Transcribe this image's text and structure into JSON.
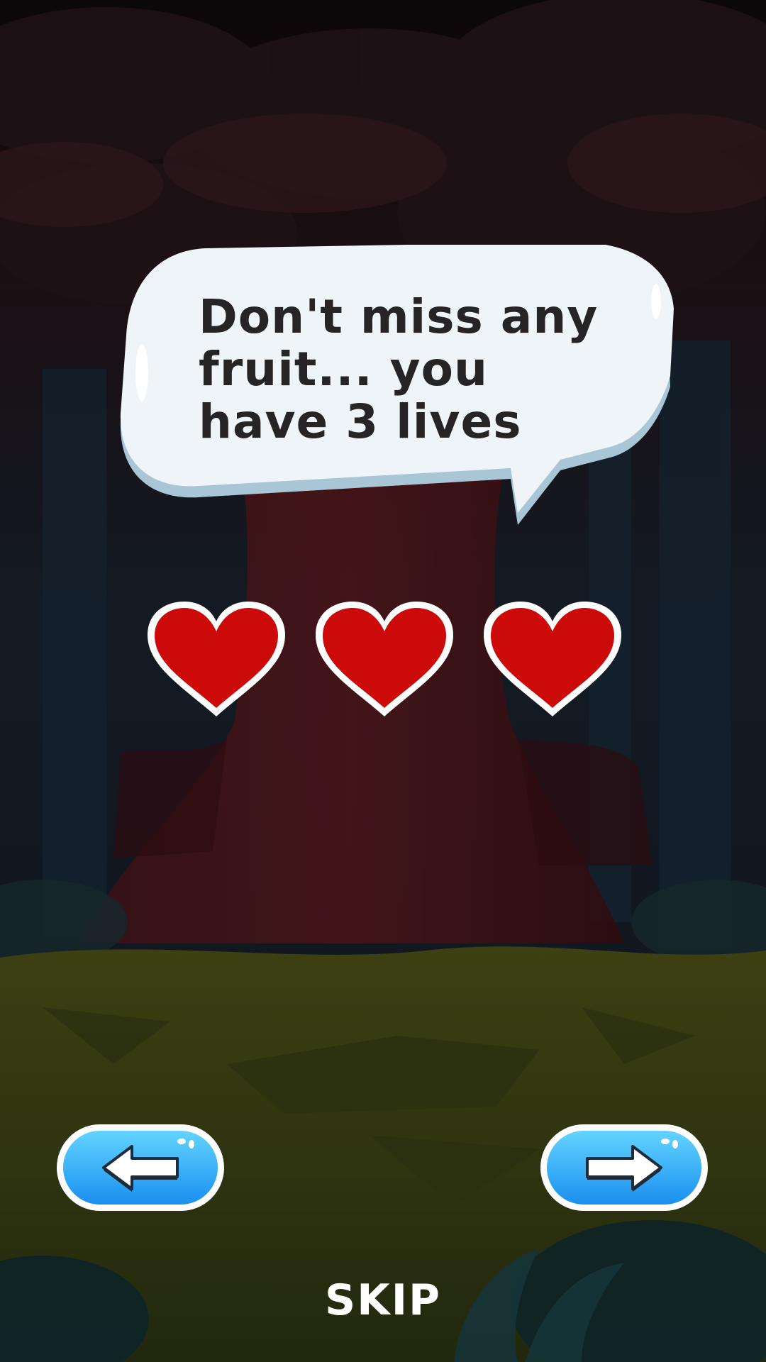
{
  "tutorial": {
    "message": "Don't miss any fruit... you have 3 lives",
    "lives": 3,
    "heart_icon": "heart-icon",
    "heart_color": "#cc0a0a"
  },
  "navigation": {
    "prev_icon": "arrow-left-icon",
    "next_icon": "arrow-right-icon",
    "button_color": "#2aa8f2",
    "skip_label": "SKIP"
  },
  "colors": {
    "bubble_fill": "#eef4f8",
    "bubble_shadow": "#a9c6d6",
    "text": "#262424"
  }
}
